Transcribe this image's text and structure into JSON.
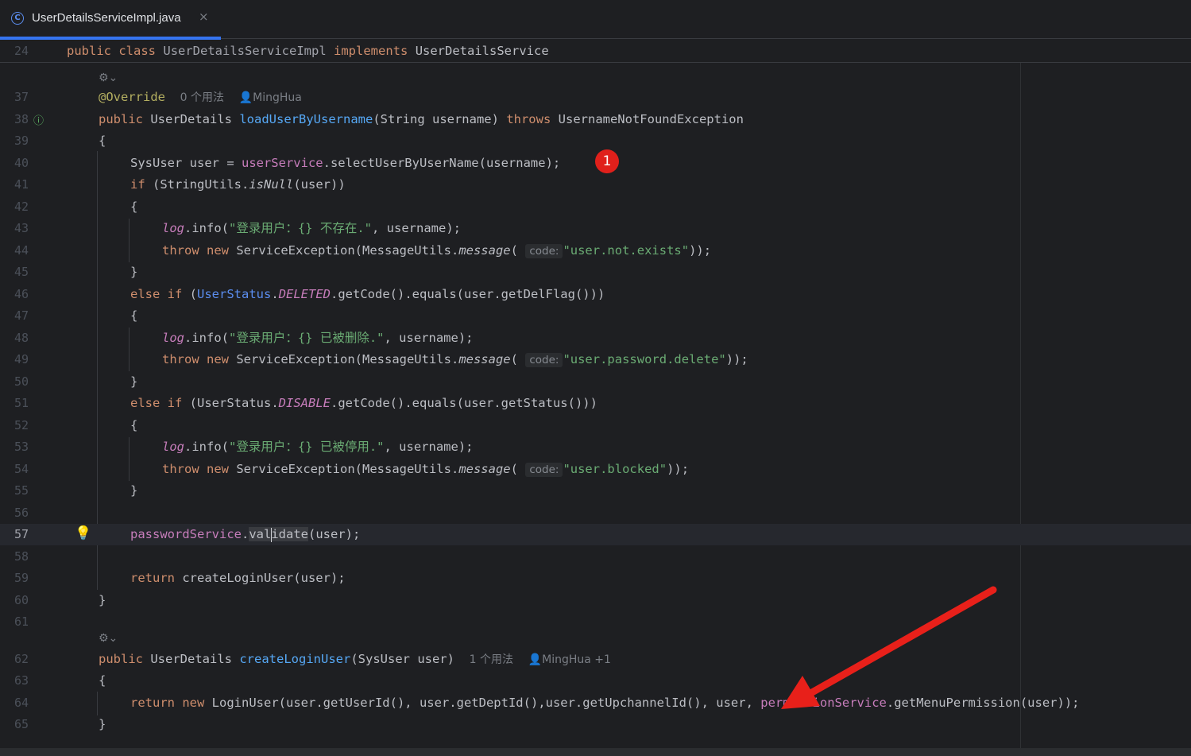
{
  "tab": {
    "title": "UserDetailsServiceImpl.java",
    "icon": "class-icon",
    "close": "×"
  },
  "sticky": {
    "line_number": "24",
    "kw1": "public",
    "kw2": "class",
    "class_name": "UserDetailsServiceImpl",
    "kw3": "implements",
    "interface": "UserDetailsService"
  },
  "lines": {
    "l37": {
      "n": "37",
      "annotation": "@Override",
      "usages": "0 个用法",
      "author": "MingHua"
    },
    "l38": {
      "n": "38",
      "kw": "public",
      "type": "UserDetails",
      "method": "loadUserByUsername",
      "params": "(String username)",
      "throws": "throws",
      "exception": "UsernameNotFoundException"
    },
    "l39": {
      "n": "39",
      "text": "{"
    },
    "l40": {
      "n": "40",
      "a": "SysUser user = ",
      "field": "userService",
      "b": ".selectUserByUserName(username);"
    },
    "l41": {
      "n": "41",
      "kw": "if",
      "a": " (StringUtils.",
      "m": "isNull",
      "b": "(user))"
    },
    "l42": {
      "n": "42",
      "text": "{"
    },
    "l43": {
      "n": "43",
      "log": "log",
      "a": ".info(",
      "str": "\"登录用户：{} 不存在.\"",
      "b": ", username);"
    },
    "l44": {
      "n": "44",
      "kw1": "throw",
      "kw2": "new",
      "a": " ServiceException(MessageUtils.",
      "m": "message",
      "b": "(",
      "hint": "code:",
      "str": "\"user.not.exists\"",
      "c": "));"
    },
    "l45": {
      "n": "45",
      "text": "}"
    },
    "l46": {
      "n": "46",
      "kw1": "else",
      "kw2": "if",
      "a": " (",
      "cls": "UserStatus",
      "dot": ".",
      "st": "DELETED",
      "b": ".getCode().equals(user.getDelFlag()))"
    },
    "l47": {
      "n": "47",
      "text": "{"
    },
    "l48": {
      "n": "48",
      "log": "log",
      "a": ".info(",
      "str": "\"登录用户：{} 已被删除.\"",
      "b": ", username);"
    },
    "l49": {
      "n": "49",
      "kw1": "throw",
      "kw2": "new",
      "a": " ServiceException(MessageUtils.",
      "m": "message",
      "b": "(",
      "hint": "code:",
      "str": "\"user.password.delete\"",
      "c": "));"
    },
    "l50": {
      "n": "50",
      "text": "}"
    },
    "l51": {
      "n": "51",
      "kw1": "else",
      "kw2": "if",
      "a": " (UserStatus.",
      "st": "DISABLE",
      "b": ".getCode().equals(user.getStatus()))"
    },
    "l52": {
      "n": "52",
      "text": "{"
    },
    "l53": {
      "n": "53",
      "log": "log",
      "a": ".info(",
      "str": "\"登录用户：{} 已被停用.\"",
      "b": ", username);"
    },
    "l54": {
      "n": "54",
      "kw1": "throw",
      "kw2": "new",
      "a": " ServiceException(MessageUtils.",
      "m": "message",
      "b": "(",
      "hint": "code:",
      "str": "\"user.blocked\"",
      "c": "));"
    },
    "l55": {
      "n": "55",
      "text": "}"
    },
    "l56": {
      "n": "56"
    },
    "l57": {
      "n": "57",
      "field": "passwordService",
      "dot": ".",
      "m1": "val",
      "m2": "idate",
      "b": "(user);"
    },
    "l58": {
      "n": "58"
    },
    "l59": {
      "n": "59",
      "kw": "return",
      "a": " createLoginUser(user);"
    },
    "l60": {
      "n": "60",
      "text": "}"
    },
    "l61": {
      "n": "61"
    },
    "l62": {
      "n": "62",
      "kw": "public",
      "type": "UserDetails",
      "method": "createLoginUser",
      "params": "(SysUser user)",
      "usages": "1 个用法",
      "author": "MingHua +1"
    },
    "l63": {
      "n": "63",
      "text": "{"
    },
    "l64": {
      "n": "64",
      "kw1": "return",
      "kw2": "new",
      "a": " LoginUser(user.getUserId(), user.getDeptId(),user.getUpchannelId(), user, ",
      "field": "permissionService",
      "b": ".getMenuPermission(user));"
    },
    "l65": {
      "n": "65",
      "text": "}"
    }
  },
  "badge": "1",
  "colors": {
    "accent": "#3574f0",
    "badge": "#e0201b",
    "arrow": "#e8201a"
  }
}
